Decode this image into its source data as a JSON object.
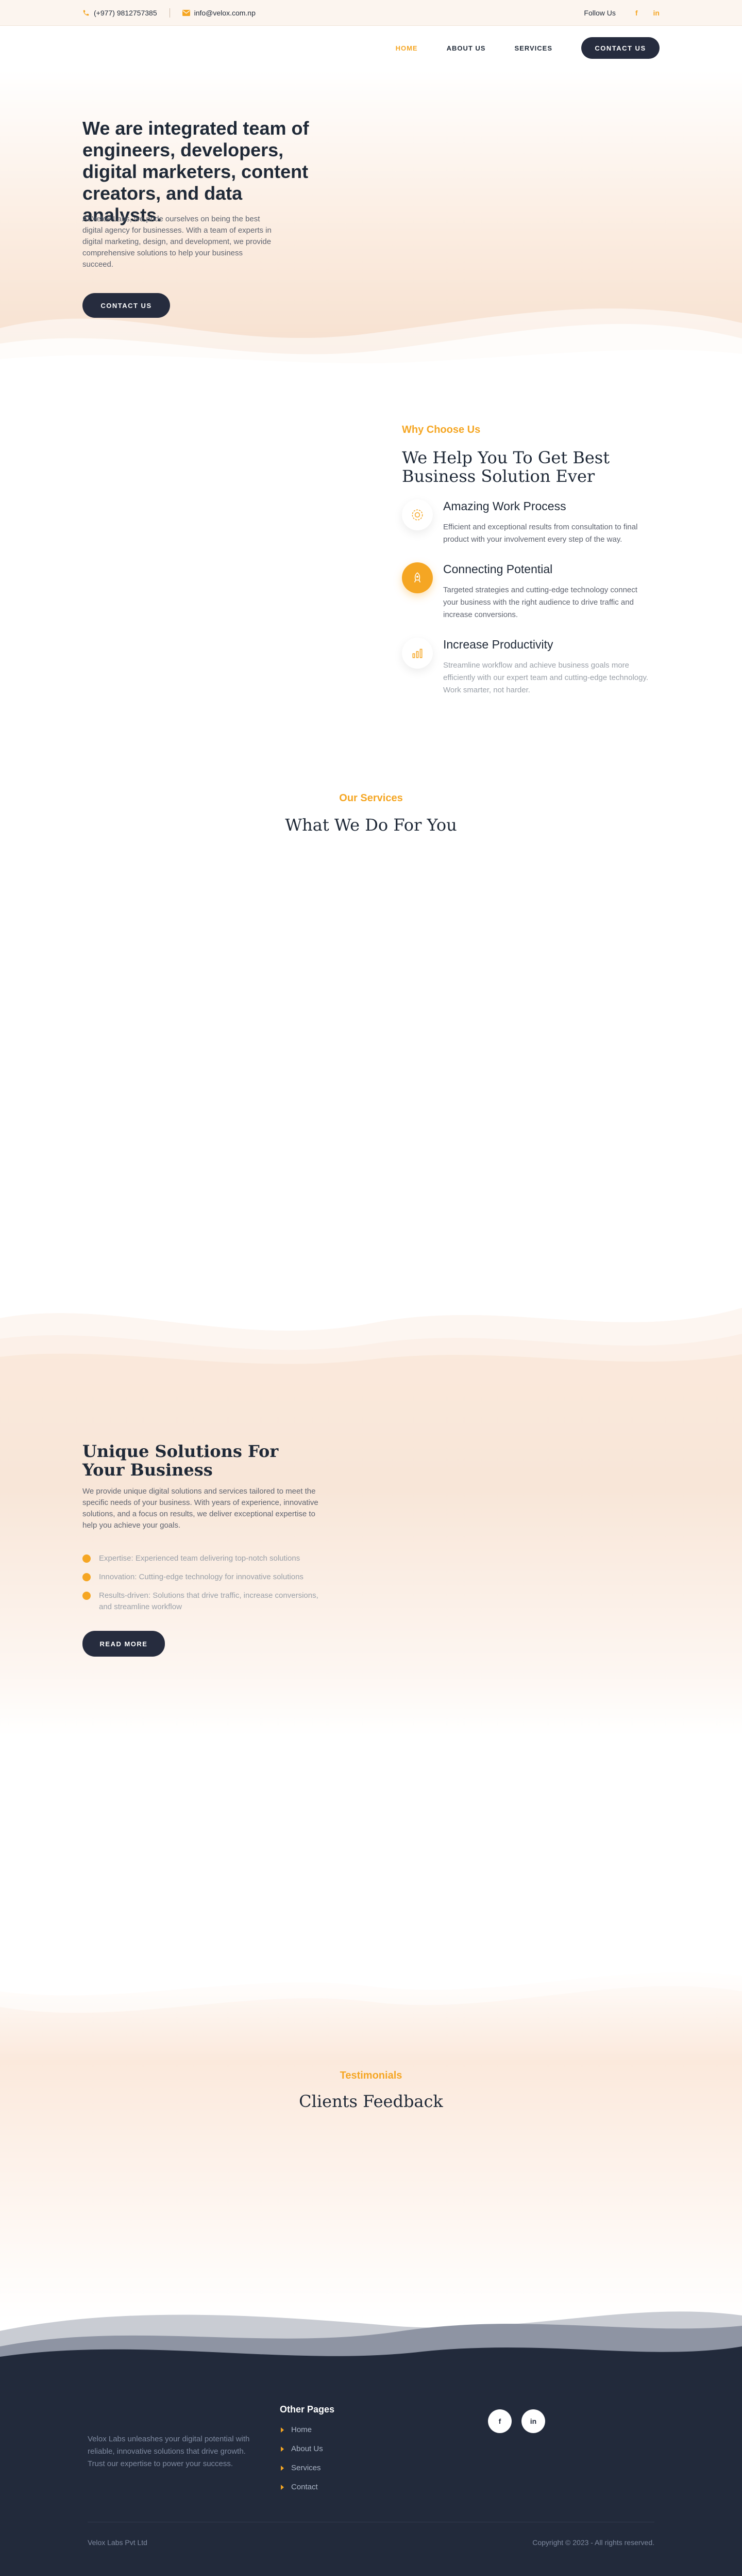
{
  "topbar": {
    "phone": "(+977) 9812757385",
    "email": "info@velox.com.np",
    "follow_label": "Follow Us",
    "social": [
      "f",
      "in"
    ]
  },
  "nav": {
    "items": [
      "HOME",
      "ABOUT US",
      "SERVICES"
    ],
    "active": "HOME",
    "cta": "CONTACT US"
  },
  "hero": {
    "heading": "We are integrated team of engineers, developers, digital marketers, content creators, and data analysts.",
    "text": "At Velox Labs, we pride ourselves on being the best digital agency for businesses. With a team of experts in digital marketing, design, and development, we provide comprehensive solutions to help your business succeed.",
    "button": "CONTACT US"
  },
  "why": {
    "label": "Why Choose Us",
    "title": "We Help You To Get Best Business Solution Ever",
    "features": [
      {
        "title": "Amazing Work Process",
        "text": "Efficient and exceptional results from consultation to final product with your involvement every step of the way.",
        "icon": "gear-icon"
      },
      {
        "title": "Connecting Potential",
        "text": "Targeted strategies and cutting-edge technology connect your business with the right audience to drive traffic and increase conversions.",
        "icon": "rocket-icon"
      },
      {
        "title": "Increase Productivity",
        "text": "Streamline workflow and achieve business goals more efficiently with our expert team and cutting-edge technology. Work smarter, not harder.",
        "icon": "chart-icon"
      }
    ]
  },
  "services": {
    "label": "Our Services",
    "title": "What We Do For You"
  },
  "unique": {
    "title": "Unique Solutions For Your Business",
    "text": "We provide unique digital solutions and services tailored to meet the specific needs of your business. With years of experience, innovative solutions, and a focus on results, we deliver exceptional expertise to help you achieve your goals.",
    "points": [
      "Expertise: Experienced team delivering top-notch solutions",
      "Innovation: Cutting-edge technology for innovative solutions",
      "Results-driven: Solutions that drive traffic, increase conversions, and streamline workflow"
    ],
    "button": "READ MORE"
  },
  "testimonials": {
    "label": "Testimonials",
    "title": "Clients Feedback"
  },
  "footer": {
    "about": "Velox Labs unleashes your digital potential with reliable, innovative solutions that drive growth. Trust our expertise to power your success.",
    "pages_title": "Other Pages",
    "pages": [
      "Home",
      "About Us",
      "Services",
      "Contact"
    ],
    "social": [
      "f",
      "in"
    ],
    "company": "Velox Labs Pvt Ltd",
    "copyright": "Copyright © 2023 - All rights reserved."
  },
  "colors": {
    "accent": "#f5a623",
    "dark": "#262c3e",
    "footer_bg": "#222a3b",
    "peach": "#f6dfcd"
  }
}
